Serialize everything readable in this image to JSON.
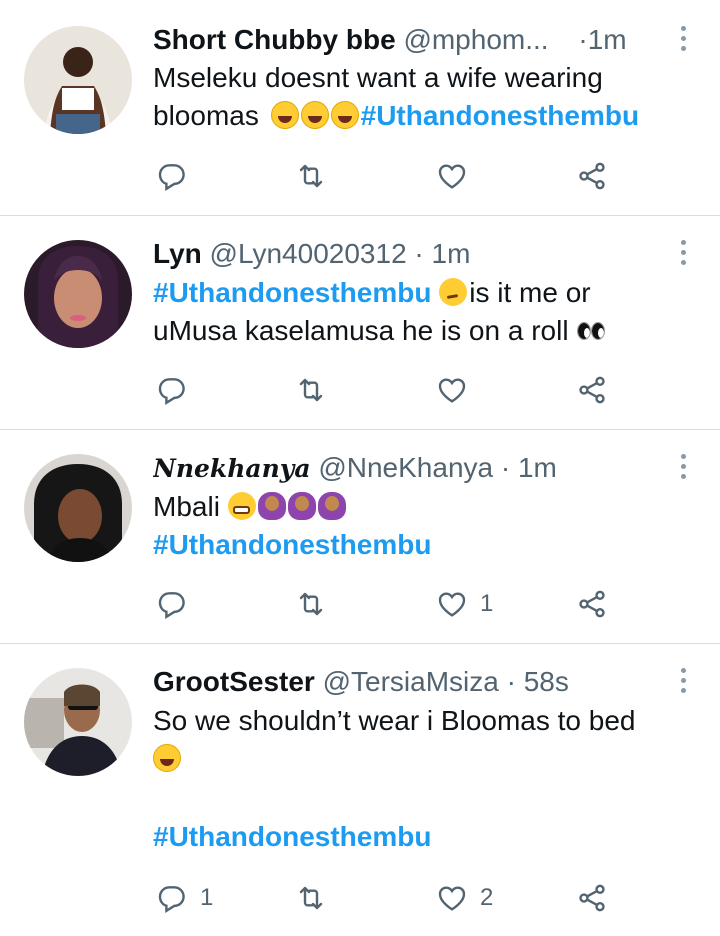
{
  "tweets": [
    {
      "name": "Short Chubby bbe",
      "handle": "@mphom...",
      "dot": "·",
      "time": "1m",
      "text1": "Mseleku doesnt want a wife wearing",
      "text2": "bloomas",
      "emojis2": [
        "laugh-sweat",
        "rofl",
        "joy"
      ],
      "hashtag": "#Uthandonesthembu",
      "reply_count": "",
      "like_count": ""
    },
    {
      "name": "Lyn",
      "handle": "@Lyn40020312",
      "dot": "·",
      "time": "1m",
      "hashtag": "#Uthandonesthembu",
      "text1": "is it me or",
      "text2": "uMusa kaselamusa he is on a roll",
      "reply_count": "",
      "like_count": ""
    },
    {
      "name": "Nnekhanya",
      "handle": "@NneKhanya",
      "dot": "·",
      "time": "1m",
      "text1": "Mbali",
      "hashtag": "#Uthandonesthembu",
      "reply_count": "",
      "like_count": "1"
    },
    {
      "name": "GrootSester",
      "handle": "@TersiaMsiza",
      "dot": "·",
      "time": "58s",
      "text1": "So we shouldn’t wear i Bloomas to bed",
      "hashtag": "#Uthandonesthembu",
      "reply_count": "1",
      "like_count": "2"
    }
  ],
  "icons": [
    "reply-icon",
    "retweet-icon",
    "like-icon",
    "share-icon",
    "more-icon"
  ],
  "colors": {
    "hashtag": "#1d9bf0",
    "meta": "#536471",
    "text": "#0f1419",
    "divider": "#d9dde1"
  }
}
